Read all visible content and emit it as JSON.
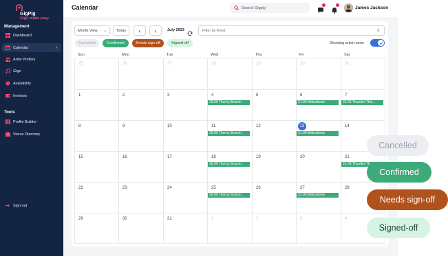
{
  "app": {
    "brand_name": "GigPig",
    "brand_tagline": "Gigs made easy"
  },
  "sidebar": {
    "management_label": "Management",
    "items": [
      {
        "label": "Dashboard",
        "icon": "grid-icon"
      },
      {
        "label": "Calendar",
        "icon": "calendar-icon",
        "active": true
      },
      {
        "label": "Artist Profiles",
        "icon": "users-icon"
      },
      {
        "label": "Gigs",
        "icon": "music-icon"
      },
      {
        "label": "Availability",
        "icon": "clock-icon"
      },
      {
        "label": "Invoices",
        "icon": "wallet-icon"
      }
    ],
    "tools_label": "Tools",
    "tools": [
      {
        "label": "Profile Builder",
        "icon": "columns-icon"
      },
      {
        "label": "Venue Directory",
        "icon": "building-icon"
      }
    ],
    "signout_label": "Sign out"
  },
  "header": {
    "title": "Calendar",
    "search_placeholder": "Search Gigpig",
    "user_name": "James Jackson"
  },
  "toolbar": {
    "view_select": "Month View",
    "today_label": "Today",
    "prev_symbol": "‹",
    "next_symbol": "›",
    "month_label": "July 2023",
    "filter_placeholder": "Filter by Artist"
  },
  "status_filters": {
    "cancelled": "Cancelled",
    "confirmed": "Confirmed",
    "needs_signoff": "Needs sign-off",
    "signed_off": "Signed-off"
  },
  "artist_toggle": {
    "label": "Showing artist name",
    "on": true
  },
  "calendar": {
    "weekdays": [
      "Sun",
      "Mon",
      "Tue",
      "Wed",
      "Thu",
      "Fri",
      "Sat"
    ],
    "weeks": [
      [
        {
          "d": "25",
          "m": true
        },
        {
          "d": "26",
          "m": true
        },
        {
          "d": "27",
          "m": true
        },
        {
          "d": "28",
          "m": true
        },
        {
          "d": "29",
          "m": true
        },
        {
          "d": "30",
          "m": true
        },
        {
          "d": "31",
          "m": true
        }
      ],
      [
        {
          "d": "1"
        },
        {
          "d": "2"
        },
        {
          "d": "3"
        },
        {
          "d": "4",
          "ev": [
            "20:00 Thorny Branch"
          ]
        },
        {
          "d": "5"
        },
        {
          "d": "6",
          "ev": [
            "21:00 Metrodome"
          ]
        },
        {
          "d": "7",
          "ev": [
            "21:00 Thunder This..."
          ]
        }
      ],
      [
        {
          "d": "8"
        },
        {
          "d": "9"
        },
        {
          "d": "10"
        },
        {
          "d": "11",
          "ev": [
            "20:00 Thorny Branch"
          ]
        },
        {
          "d": "12"
        },
        {
          "d": "13",
          "today": true,
          "ev": [
            "21:00 Metrodome"
          ]
        },
        {
          "d": "14"
        }
      ],
      [
        {
          "d": "15"
        },
        {
          "d": "16"
        },
        {
          "d": "17"
        },
        {
          "d": "18",
          "ev": [
            "20:00 Thorny Branch"
          ]
        },
        {
          "d": "19"
        },
        {
          "d": "20"
        },
        {
          "d": "21",
          "ev": [
            "21:00 Thunder Th"
          ]
        }
      ],
      [
        {
          "d": "22"
        },
        {
          "d": "23"
        },
        {
          "d": "24"
        },
        {
          "d": "25",
          "ev": [
            "20:00 Thorny Branch"
          ]
        },
        {
          "d": "26"
        },
        {
          "d": "27",
          "ev": [
            "21:00 Metrodome"
          ]
        },
        {
          "d": "28"
        }
      ],
      [
        {
          "d": "29"
        },
        {
          "d": "30"
        },
        {
          "d": "31"
        },
        {
          "d": "1",
          "m": true
        },
        {
          "d": "2",
          "m": true
        },
        {
          "d": "3",
          "m": true
        },
        {
          "d": "4",
          "m": true
        }
      ]
    ]
  },
  "legend": {
    "cancelled": "Cancelled",
    "confirmed": "Confirmed",
    "needs_signoff": "Needs sign-off",
    "signed_off": "Signed-off"
  },
  "colors": {
    "sidebar_bg": "#142544",
    "confirmed": "#3daa7a",
    "needs_signoff": "#b0521b",
    "signed_off_bg": "#d7f3e3",
    "cancelled_bg": "#eceef1",
    "accent_blue": "#3b6fd8",
    "brand_pink": "#ef4f6b"
  }
}
